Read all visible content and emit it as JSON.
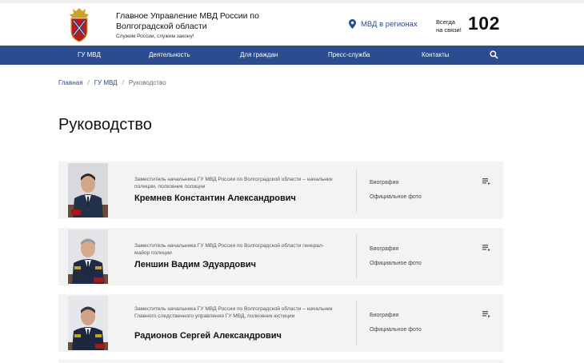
{
  "header": {
    "org_title": "Главное Управление МВД России по Волгоградской области",
    "motto": "Служим России, служим закону!",
    "region_link": "МВД в регионах",
    "always_line1": "Всегда",
    "always_line2": "на связи!",
    "phone": "102"
  },
  "nav": {
    "items": [
      {
        "label": "ГУ МВД"
      },
      {
        "label": "Деятельность"
      },
      {
        "label": "Для граждан"
      },
      {
        "label": "Пресс-служба"
      },
      {
        "label": "Контакты"
      }
    ]
  },
  "breadcrumb": {
    "home": "Главная",
    "section": "ГУ МВД",
    "current": "Руководство",
    "separator": "/"
  },
  "page": {
    "title": "Руководство"
  },
  "leaders": [
    {
      "position": "Заместитель начальника ГУ МВД России по Волгоградской области – начальник полиции, полковник полиции",
      "name": "Кремнев Константин Александрович",
      "bio_label": "Биография",
      "photo_label": "Официальное фото"
    },
    {
      "position": "Заместитель начальника ГУ МВД России по Волгоградской области генерал-майор полиции",
      "name": "Леншин Вадим Эдуардович",
      "bio_label": "Биография",
      "photo_label": "Официальное фото"
    },
    {
      "position": "Заместитель начальника ГУ МВД России по Волгоградской области – начальник Главного следственного управления ГУ МВД, полковник юстиции",
      "name": "Радионов Сергей Александрович",
      "bio_label": "Биография",
      "photo_label": "Официальное фото"
    }
  ],
  "icons": {
    "logo": "mvd-emblem-icon",
    "region": "location-pin-icon",
    "search": "search-icon",
    "menu": "list-menu-icon"
  },
  "colors": {
    "nav_bg": "#2b4c8e",
    "link": "#2b4a8a",
    "card_bg": "#f3f3f4"
  }
}
